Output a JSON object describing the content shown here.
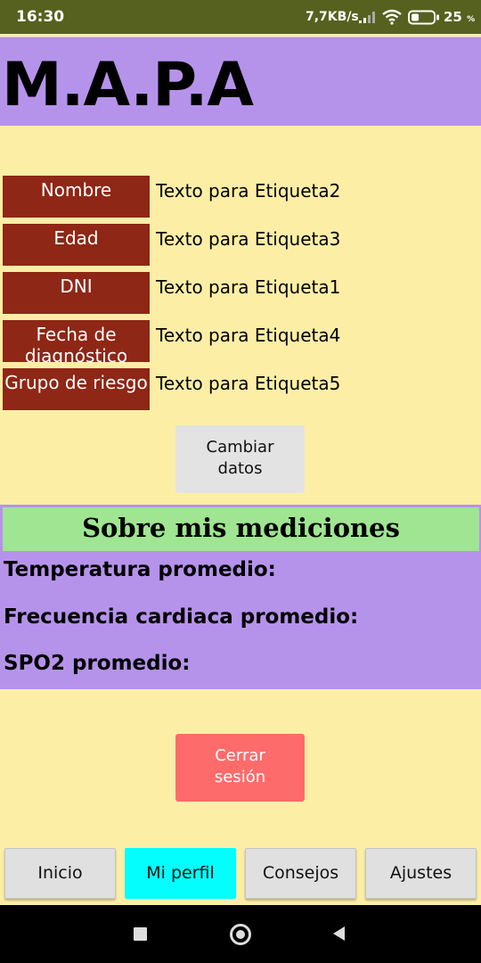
{
  "status_bar": {
    "time": "16:30",
    "network_speed": "7,7KB/s",
    "battery_percent": "25",
    "battery_unit": "%",
    "icons": [
      "signal-icon",
      "wifi-icon",
      "battery-icon"
    ]
  },
  "header": {
    "title": "M.A.P.A"
  },
  "profile": {
    "fields": [
      {
        "label": "Nombre",
        "value": "Texto para Etiqueta2"
      },
      {
        "label": "Edad",
        "value": "Texto para Etiqueta3"
      },
      {
        "label": "DNI",
        "value": "Texto para Etiqueta1"
      },
      {
        "label": "Fecha de diagnóstico",
        "value": "Texto para Etiqueta4"
      },
      {
        "label": "Grupo de riesgo",
        "value": "Texto para Etiqueta5"
      }
    ],
    "change_button": {
      "line1": "Cambiar",
      "line2": "datos"
    }
  },
  "measurements": {
    "title": "Sobre mis mediciones",
    "rows": [
      "Temperatura promedio:",
      "Frecuencia cardiaca promedio:",
      "SPO2 promedio:"
    ]
  },
  "logout_button": {
    "line1": "Cerrar",
    "line2": "sesión"
  },
  "bottom_nav": {
    "items": [
      "Inicio",
      "Mi perfil",
      "Consejos",
      "Ajustes"
    ],
    "active": "Mi perfil"
  },
  "colors": {
    "background": "#fdeea6",
    "status_bar": "#56611f",
    "header": "#b693eb",
    "label_box": "#8e2716",
    "measure_header": "#a0e592",
    "logout": "#fe6b6b",
    "active_nav": "#04fdfd"
  },
  "system_nav": {
    "icons": [
      "recents-icon",
      "home-icon",
      "back-icon"
    ]
  }
}
